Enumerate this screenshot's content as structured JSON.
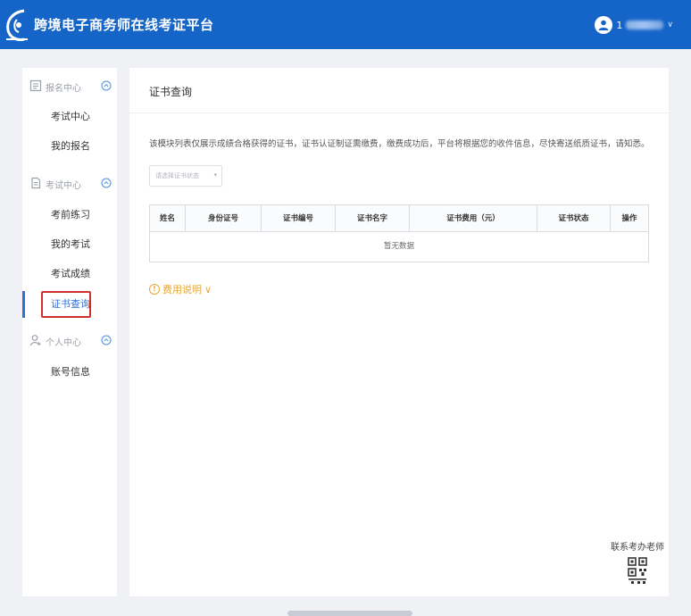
{
  "header": {
    "site_title": "跨境电子商务师在线考证平台",
    "user_prefix": "1",
    "user_caret": "∨"
  },
  "sidebar": {
    "groups": [
      {
        "label": "报名中心",
        "icon": "form-icon",
        "items": [
          "考试中心",
          "我的报名"
        ]
      },
      {
        "label": "考试中心",
        "icon": "document-icon",
        "items": [
          "考前练习",
          "我的考试",
          "考试成绩",
          "证书查询"
        ]
      },
      {
        "label": "个人中心",
        "icon": "person-icon",
        "items": [
          "账号信息"
        ]
      }
    ],
    "active_item": "证书查询"
  },
  "main": {
    "title": "证书查询",
    "notice": "该模块列表仅展示成绩合格获得的证书，证书认证制证需缴费，缴费成功后，平台将根据您的收件信息，尽快寄送纸质证书，请知悉。",
    "select_placeholder": "请选择证书状态",
    "table": {
      "columns": [
        "姓名",
        "身份证号",
        "证书编号",
        "证书名字",
        "证书费用（元）",
        "证书状态",
        "操作"
      ],
      "empty_text": "暂无数据"
    },
    "fee_info_label": "费用说明",
    "fee_info_caret": "∨",
    "fee_icon_glyph": "!"
  },
  "contact": {
    "label": "联系考办老师"
  },
  "colors": {
    "header_bg": "#1565c8",
    "accent": "#2f6fd6",
    "fee_orange": "#e8a735",
    "highlight_red": "#d0302c"
  }
}
